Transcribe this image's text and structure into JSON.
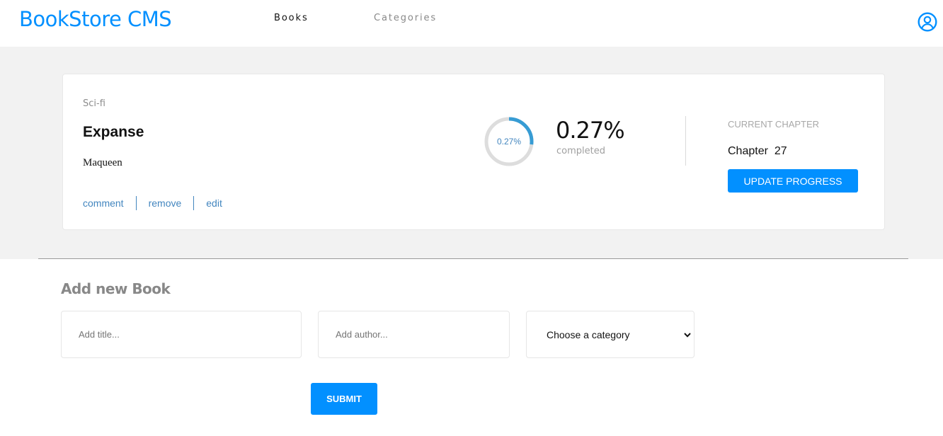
{
  "header": {
    "logo": "BookStore CMS",
    "nav": [
      {
        "label": "Books",
        "active": true
      },
      {
        "label": "Categories",
        "active": false
      }
    ],
    "user_icon": "user-circle-icon"
  },
  "book": {
    "genre": "Sci-fi",
    "title": "Expanse",
    "author": "Maqueen",
    "actions": [
      "comment",
      "remove",
      "edit"
    ],
    "progress": {
      "percent_value": 0.27,
      "ring_label": "0.27%",
      "percent_text": "0.27%",
      "completed_label": "completed"
    },
    "chapter": {
      "label": "CURRENT CHAPTER",
      "value": "Chapter  27"
    },
    "update_button": "UPDATE PROGRESS"
  },
  "form": {
    "title": "Add new Book",
    "title_placeholder": "Add title...",
    "author_placeholder": "Add author...",
    "category_selected": "Choose a category",
    "submit_label": "SUBMIT"
  },
  "colors": {
    "accent": "#0290ff",
    "link": "#4386bf",
    "ring_track": "#dddddd"
  }
}
